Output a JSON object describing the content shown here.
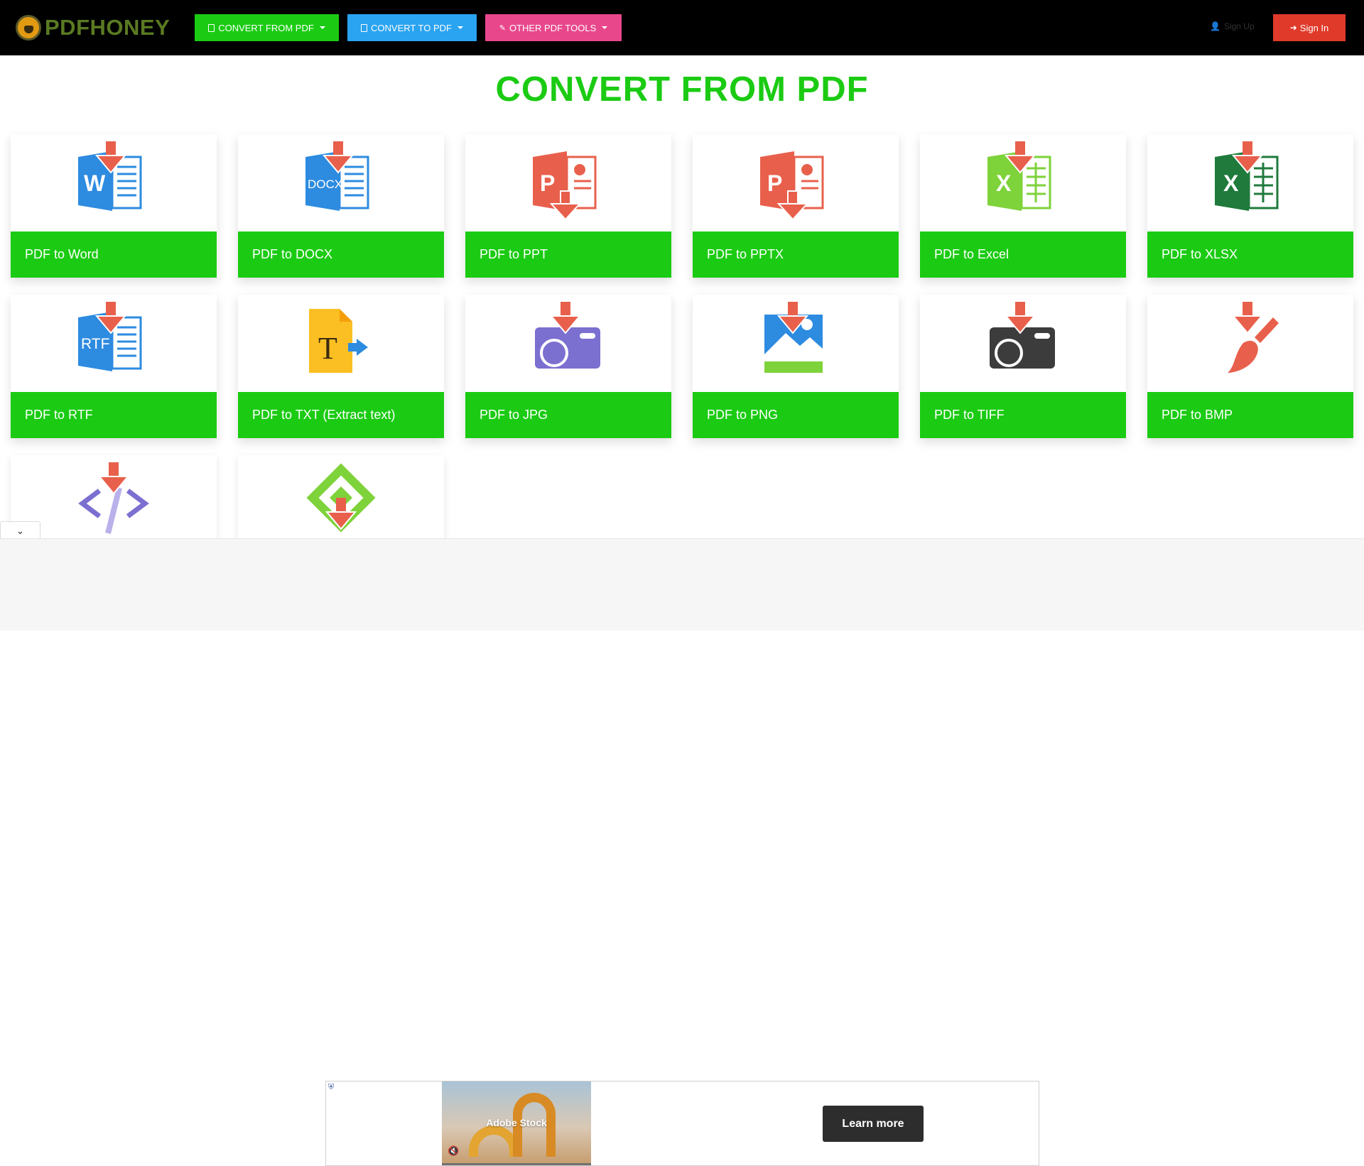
{
  "navbar": {
    "brand": "PDFHONEY",
    "convert_from": "CONVERT FROM PDF",
    "convert_to": "CONVERT TO PDF",
    "other_tools": "OTHER PDF TOOLS",
    "sign_up": "Sign Up",
    "sign_in": "Sign In",
    "colors": {
      "green": "#1bcb13",
      "blue": "#2aa3f0",
      "pink": "#e8478c",
      "red": "#e03a2a"
    }
  },
  "page": {
    "title": "CONVERT FROM PDF"
  },
  "tools": [
    {
      "label": "PDF to Word",
      "icon": "word-doc-icon"
    },
    {
      "label": "PDF to DOCX",
      "icon": "docx-doc-icon"
    },
    {
      "label": "PDF to PPT",
      "icon": "ppt-doc-icon"
    },
    {
      "label": "PDF to PPTX",
      "icon": "pptx-doc-icon"
    },
    {
      "label": "PDF to Excel",
      "icon": "excel-doc-icon"
    },
    {
      "label": "PDF to XLSX",
      "icon": "xlsx-doc-icon"
    },
    {
      "label": "PDF to RTF",
      "icon": "rtf-doc-icon"
    },
    {
      "label": "PDF to TXT (Extract text)",
      "icon": "txt-file-icon"
    },
    {
      "label": "PDF to JPG",
      "icon": "camera-icon"
    },
    {
      "label": "PDF to PNG",
      "icon": "image-icon"
    },
    {
      "label": "PDF to TIFF",
      "icon": "camera-dark-icon"
    },
    {
      "label": "PDF to BMP",
      "icon": "paintbrush-icon"
    },
    {
      "label": "",
      "icon": "code-icon"
    },
    {
      "label": "",
      "icon": "epub-icon"
    }
  ],
  "ad": {
    "brand": "Adobe Stock",
    "cta": "Learn more"
  }
}
